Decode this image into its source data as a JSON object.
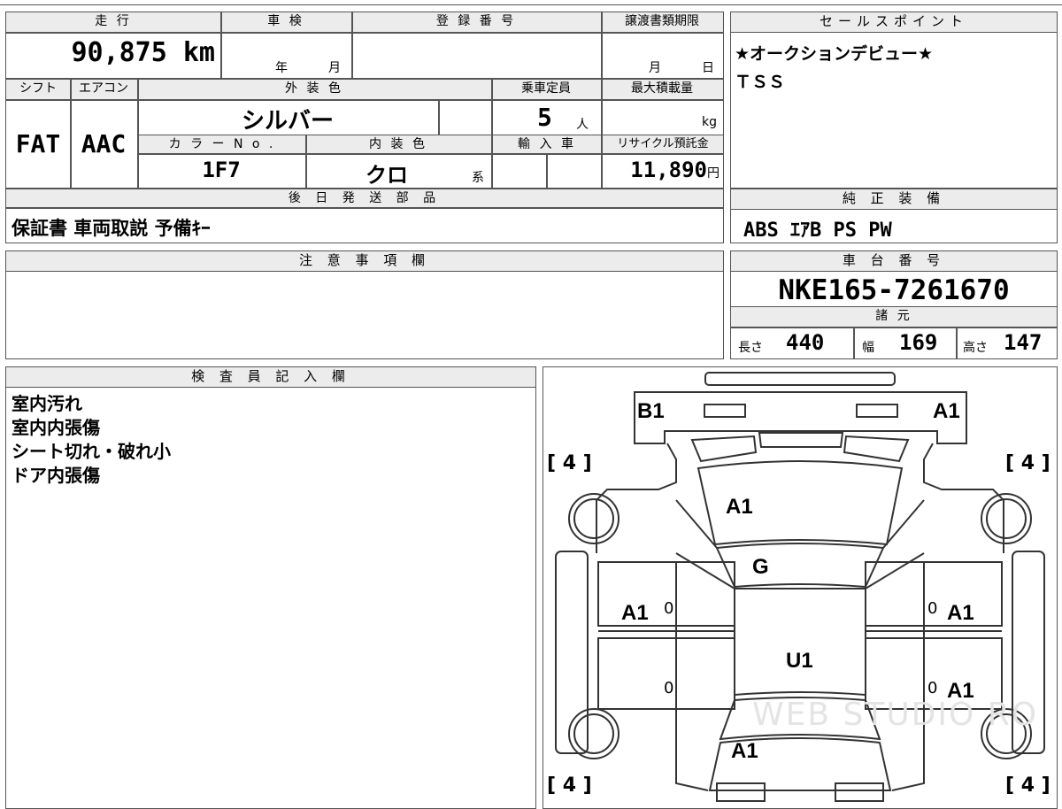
{
  "top": {
    "mileage_label": "走 行",
    "mileage_value": "90,875",
    "mileage_unit": "km",
    "inspection_label": "車 検",
    "inspection_year_unit": "年",
    "inspection_month_unit": "月",
    "registration_label": "登 録 番 号",
    "transfer_label": "譲渡書類期限",
    "transfer_month_unit": "月",
    "transfer_day_unit": "日"
  },
  "spec": {
    "shift_label": "シフト",
    "shift_value": "FAT",
    "ac_label": "エアコン",
    "ac_value": "AAC",
    "exterior_label": "外 装 色",
    "exterior_value": "シルバー",
    "capacity_label": "乗車定員",
    "capacity_value": "5",
    "capacity_unit": "人",
    "maxload_label": "最大積載量",
    "maxload_unit": "kg",
    "colorno_label": "カ ラ ー N o .",
    "colorno_value": "1F7",
    "interior_label": "内 装 色",
    "interior_value": "クロ",
    "interior_suffix": "系",
    "import_label": "輸 入 車",
    "recycle_label": "リサイクル預託金",
    "recycle_value": "11,890",
    "recycle_unit": "円"
  },
  "later_parts": {
    "label": "後 日 発 送 部 品",
    "value": "保証書 車両取説 予備ｷｰ"
  },
  "sales_point": {
    "label": "セールスポイント",
    "line1": "★オークションデビュー★",
    "line2": "ＴＳＳ"
  },
  "equipment": {
    "label": "純 正 装 備",
    "value": "ABS ｴｱB PS PW"
  },
  "notes": {
    "label": "注 意 事 項 欄"
  },
  "chassis": {
    "label": "車 台 番 号",
    "value": "NKE165-7261670"
  },
  "dims": {
    "label": "諸 元",
    "length_label": "長さ",
    "length_value": "440",
    "width_label": "幅",
    "width_value": "169",
    "height_label": "高さ",
    "height_value": "147"
  },
  "inspector": {
    "label": "検 査 員 記 入 欄",
    "lines": [
      "室内汚れ",
      "室内内張傷",
      "シート切れ・破れ小",
      "ドア内張傷"
    ]
  },
  "diagram": {
    "rear_left": "B1",
    "rear_right": "A1",
    "roof": "A1",
    "windshield": "G",
    "left_front_door": "A1",
    "right_front_door": "A1",
    "right_rear_door": "A1",
    "hood": "U1",
    "front": "A1",
    "zero_lf": "0",
    "zero_rf": "0",
    "zero_lr": "0",
    "zero_rr": "0",
    "tire_tl": "[ 4 ]",
    "tire_tr": "[ 4 ]",
    "tire_bl": "[ 4 ]",
    "tire_br": "[ 4 ]",
    "watermark": "WEB STUDIO RO"
  },
  "colors": {
    "border": "#555555",
    "header_bg": "#ececec"
  }
}
